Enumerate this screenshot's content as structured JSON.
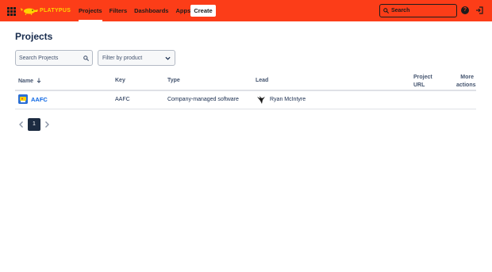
{
  "topbar": {
    "logo_text": "PLATYPUS",
    "nav": [
      {
        "label": "Projects"
      },
      {
        "label": "Filters"
      },
      {
        "label": "Dashboards"
      },
      {
        "label": "Apps"
      }
    ],
    "create_label": "Create",
    "search_placeholder": "Search",
    "help_label": "?"
  },
  "page": {
    "title": "Projects",
    "search_placeholder": "Search Projects",
    "filter_label": "Filter by product"
  },
  "table": {
    "columns": {
      "name": "Name",
      "key": "Key",
      "type": "Type",
      "lead": "Lead",
      "url_line1": "Project",
      "url_line2": "URL",
      "actions_line1": "More",
      "actions_line2": "actions"
    },
    "rows": [
      {
        "name": "AAFC",
        "key": "AAFC",
        "type": "Company-managed software",
        "lead": "Ryan McIntyre"
      }
    ]
  },
  "pagination": {
    "current": "1"
  },
  "colors": {
    "brand_bar": "#fc3d18",
    "logo": "#ffd400",
    "link": "#0c66e4",
    "page_active": "#1c2b41"
  }
}
